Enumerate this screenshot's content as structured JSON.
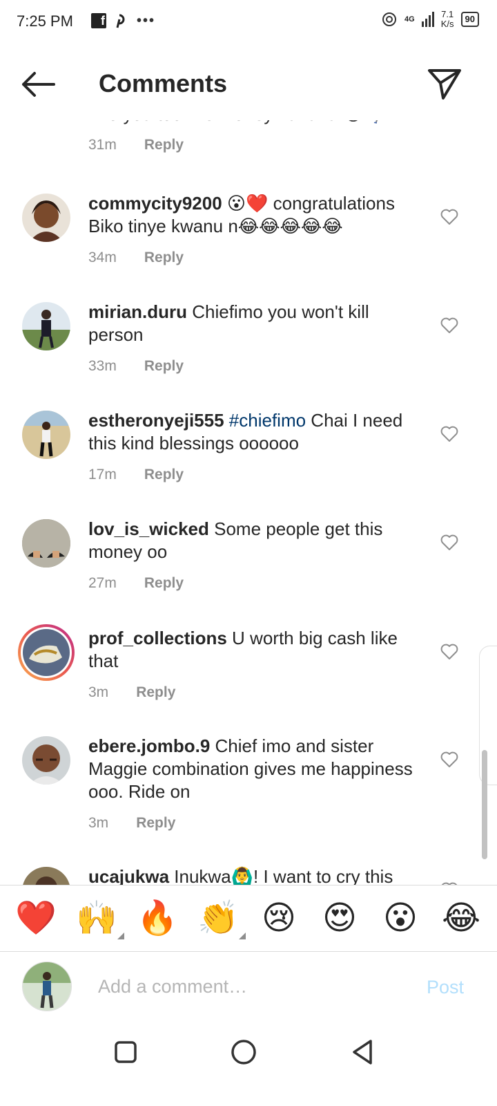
{
  "status_bar": {
    "time": "7:25 PM",
    "network": "4G",
    "speed": "7.1",
    "speed_unit": "K/s",
    "battery": "90"
  },
  "header": {
    "title": "Comments"
  },
  "partial_comment": {
    "text": "Imo you too like money hahaha 😂 🏃",
    "time": "31m",
    "reply": "Reply"
  },
  "comments": [
    {
      "user": "commycity9200",
      "text": " 😮❤️ congratulations Biko tinye kwanu n😂😂😂😂😂",
      "time": "34m",
      "reply": "Reply"
    },
    {
      "user": "mirian.duru",
      "text": " Chiefimo you won't kill person",
      "time": "33m",
      "reply": "Reply"
    },
    {
      "user": "estheronyeji555",
      "hashtag": " #chiefimo",
      "text": "  Chai I need this kind blessings oooooo",
      "time": "17m",
      "reply": "Reply"
    },
    {
      "user": "lov_is_wicked",
      "text": " Some people get this money oo",
      "time": "27m",
      "reply": "Reply"
    },
    {
      "user": "prof_collections",
      "text": " U worth big cash like that",
      "time": "3m",
      "reply": "Reply"
    },
    {
      "user": "ebere.jombo.9",
      "text": " Chief imo and sister Maggie combination gives me happiness ooo. Ride on",
      "time": "3m",
      "reply": "Reply"
    },
    {
      "user": "ucajukwa",
      "text": " Inukwa🙆‍♂️! I want to cry this",
      "time": "",
      "reply": ""
    }
  ],
  "reactions": [
    "❤️",
    "🙌",
    "🔥",
    "👏",
    "😢",
    "😍",
    "😮",
    "😂"
  ],
  "composer": {
    "placeholder": "Add a comment…",
    "post_label": "Post"
  }
}
